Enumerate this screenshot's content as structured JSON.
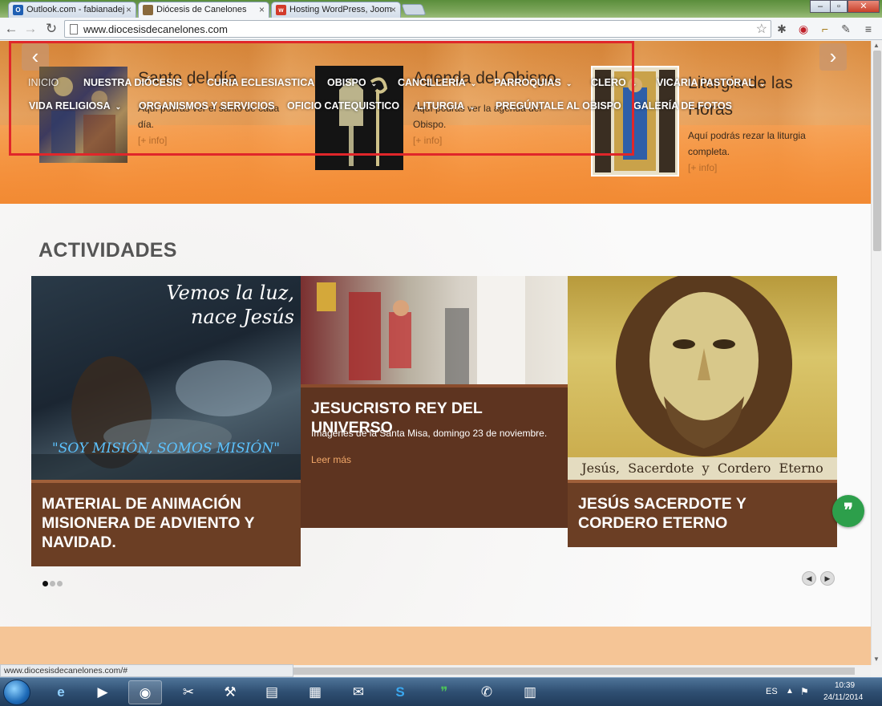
{
  "browser": {
    "tabs": [
      {
        "title": "Outlook.com - fabianadej",
        "icon": "outlook-icon",
        "color": "#1f5fb3",
        "glyph": "O"
      },
      {
        "title": "Diócesis de Canelones",
        "icon": "diocese-icon",
        "color": "#8a6a3c",
        "glyph": ""
      },
      {
        "title": "Hosting WordPress, Joom",
        "icon": "hosting-icon",
        "color": "#d23a2a",
        "glyph": "w"
      }
    ],
    "url": "www.diocesisdecanelones.com",
    "status_url": "www.diocesisdecanelones.com/#"
  },
  "hero": {
    "slides": [
      {
        "title": "Santo del día",
        "desc": "Aquí podrás ver el santo de cada día.",
        "more": "[+ info]"
      },
      {
        "title": "Agenda del Obispo",
        "desc": "Aquí podrás ver la agenda del Obispo.",
        "more": "[+ info]"
      },
      {
        "title": "Liturgia de las Horas",
        "desc": "Aquí podrás rezar la liturgia completa.",
        "more": "[+ info]"
      }
    ]
  },
  "menu": {
    "row1": [
      "INICIO",
      "NUESTRA DIÓCESIS",
      "CURIA ECLESIASTICA",
      "OBISPO",
      "CANCILLERÍA",
      "PARROQUIAS",
      "CLERO",
      "VICARIA PASTORAL"
    ],
    "row2": [
      "VIDA RELIGIOSA",
      "ORGANISMOS Y SERVICIOS",
      "OFICIO CATEQUISTICO",
      "LITURGIA",
      "PREGÚNTALE AL OBISPO",
      "GALERÍA DE FOTOS"
    ]
  },
  "activities": {
    "heading": "ACTIVIDADES",
    "cards": [
      {
        "title": "MATERIAL DE ANIMACIÓN MISIONERA DE ADVIENTO Y NAVIDAD.",
        "image_text_1": "Vemos la luz,",
        "image_text_2": "nace Jesús",
        "image_text_3": "\"SOY MISIÓN, SOMOS MISIÓN\""
      },
      {
        "title": "JESUCRISTO REY DEL UNIVERSO",
        "desc": "Imágenes de la Santa Misa, domingo 23 de noviembre.",
        "more": "Leer más"
      },
      {
        "title": "JESÚS SACERDOTE Y CORDERO ETERNO",
        "image_caption": "Jesús,  Sacerdote  y  Cordero  Eterno"
      }
    ]
  },
  "taskbar": {
    "lang": "ES",
    "time": "10:39",
    "date": "24/11/2014"
  },
  "colors": {
    "accent_brown": "#6b3e24",
    "highlight_red": "#e0262a",
    "hero_orange": "#ee9a48",
    "quote_green": "#2d9f4b"
  }
}
